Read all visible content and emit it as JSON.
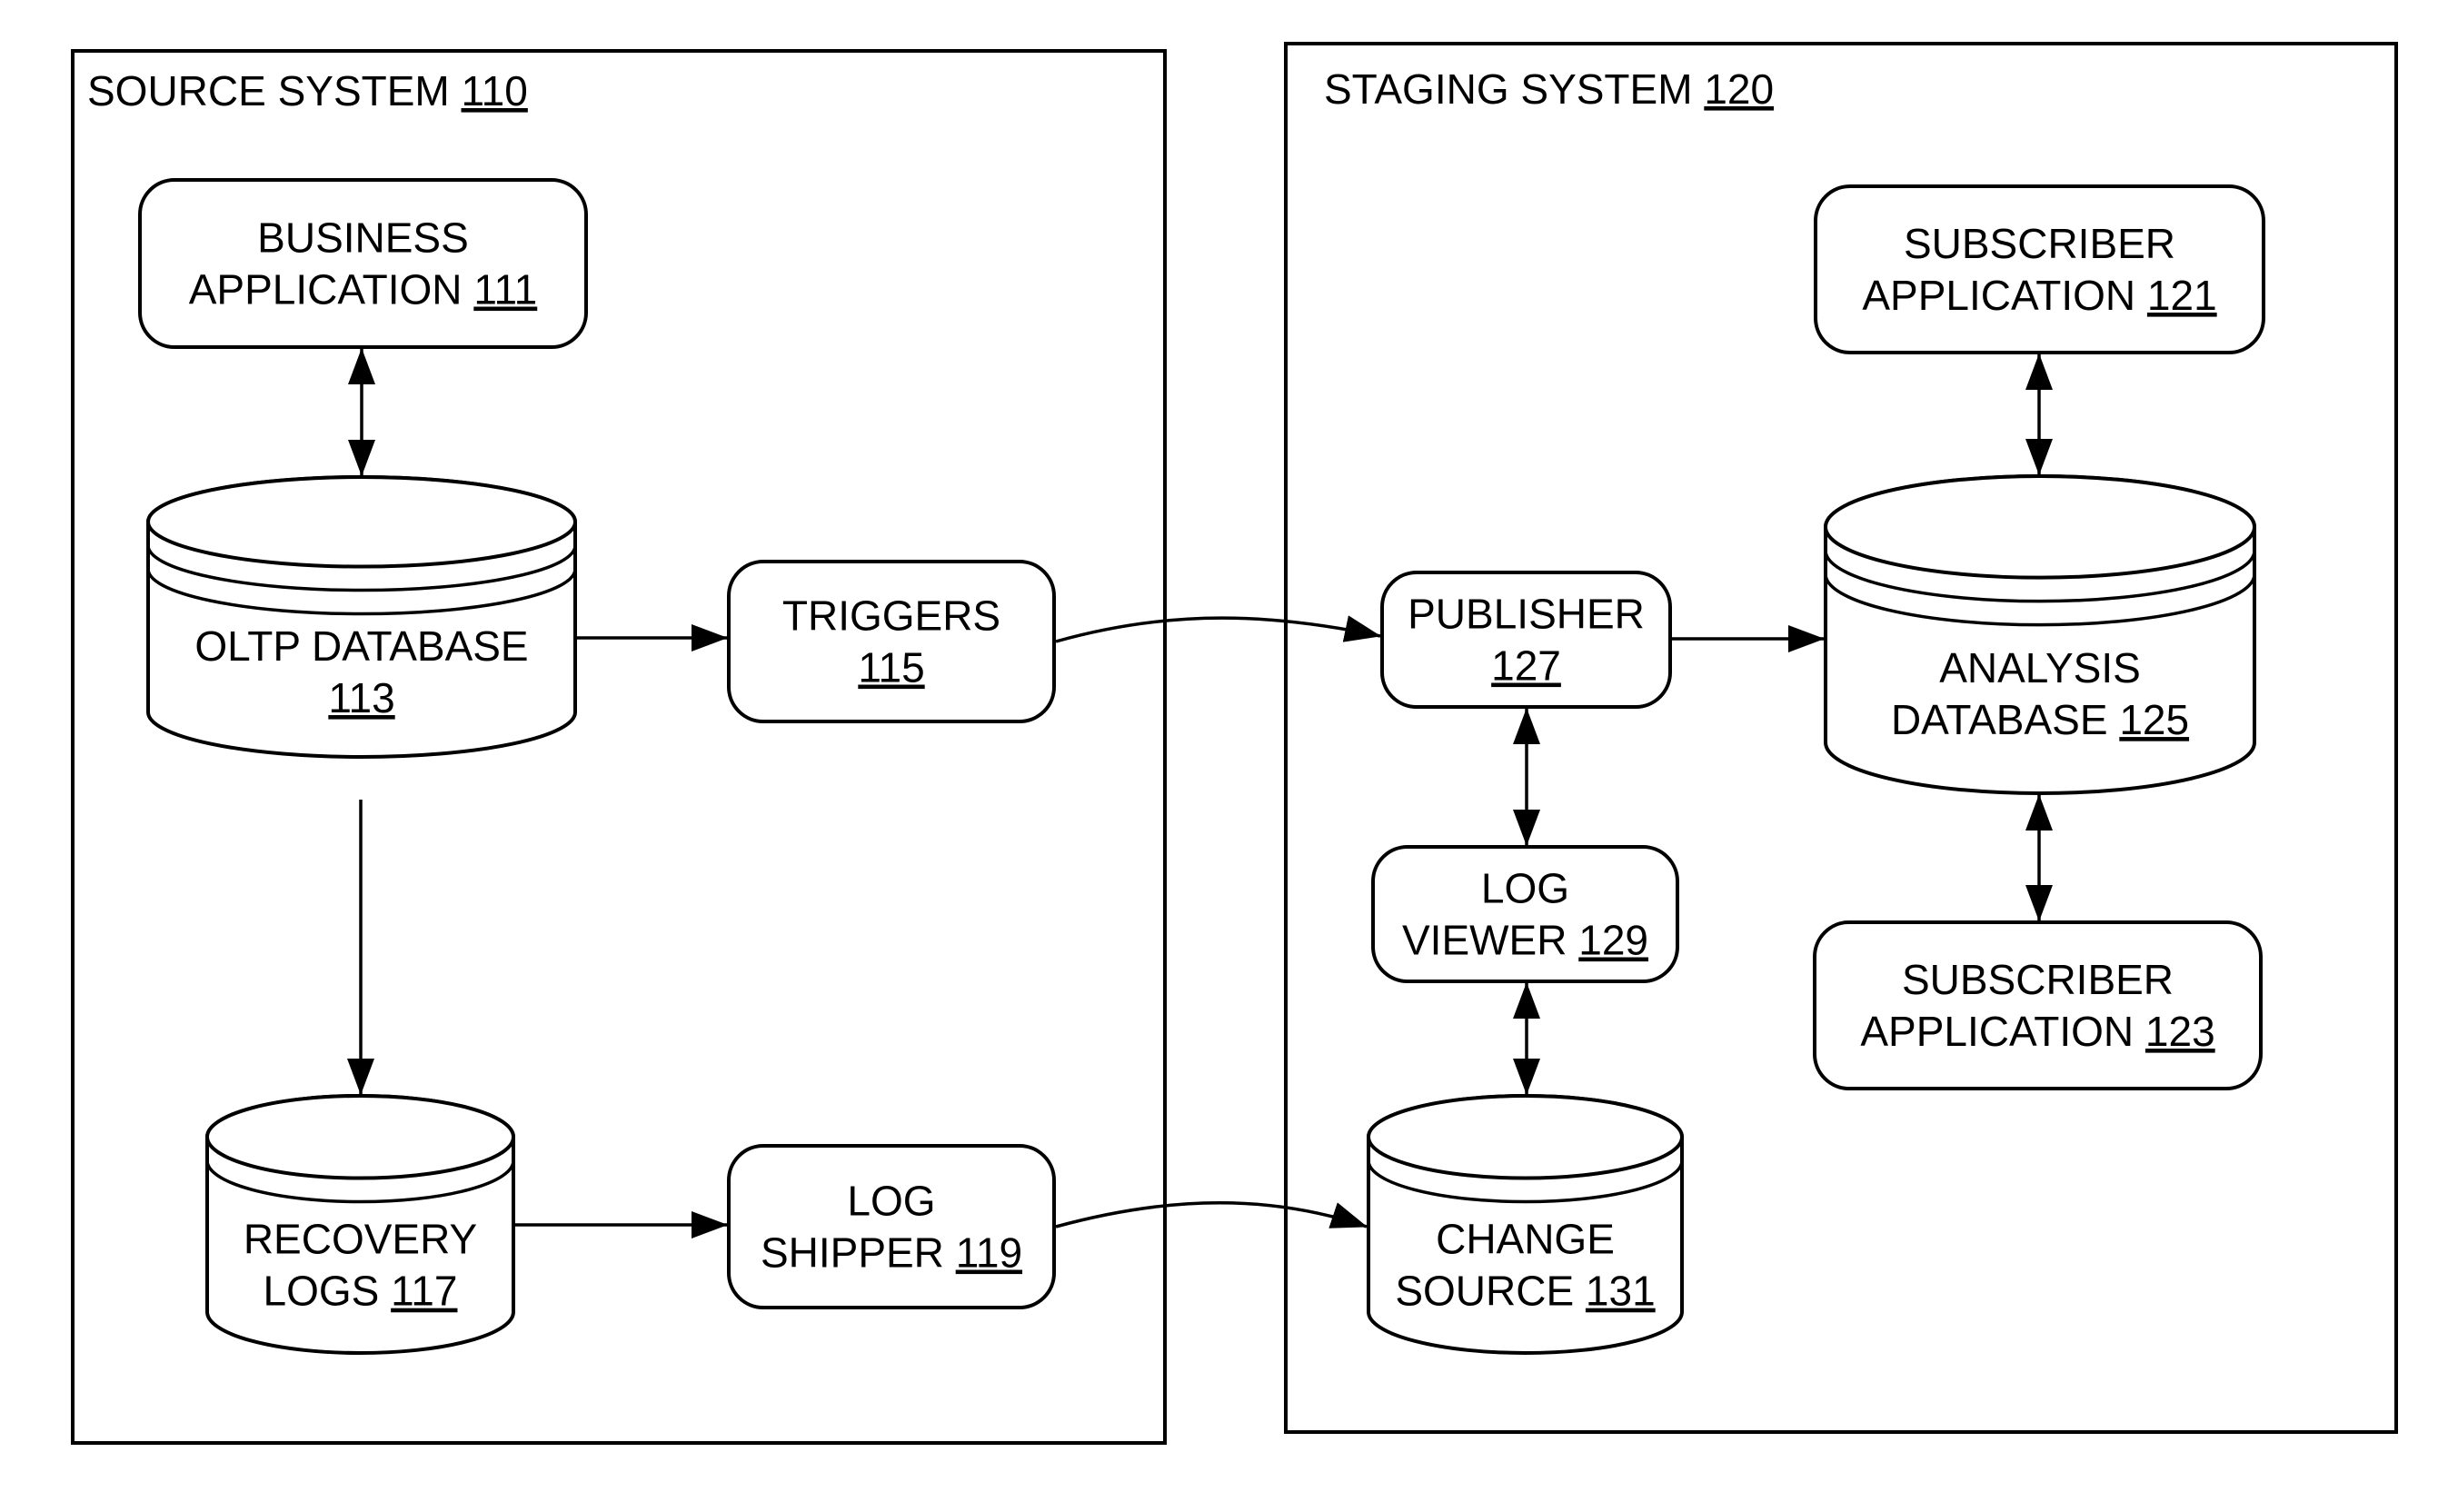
{
  "containers": [
    {
      "id": "source",
      "label": "SOURCE SYSTEM",
      "ref": "110"
    },
    {
      "id": "staging",
      "label": "STAGING SYSTEM",
      "ref": "120"
    }
  ],
  "nodes": [
    {
      "id": "business_app",
      "type": "process",
      "lines": [
        "BUSINESS",
        "APPLICATION"
      ],
      "ref": "111"
    },
    {
      "id": "oltp_db",
      "type": "database",
      "lines": [
        "OLTP DATABASE"
      ],
      "ref": "113",
      "ref_own_line": true
    },
    {
      "id": "triggers",
      "type": "process",
      "lines": [
        "TRIGGERS"
      ],
      "ref": "115",
      "ref_own_line": true
    },
    {
      "id": "recovery_logs",
      "type": "database",
      "lines": [
        "RECOVERY",
        "LOGS"
      ],
      "ref": "117"
    },
    {
      "id": "log_shipper",
      "type": "process",
      "lines": [
        "LOG",
        "SHIPPER"
      ],
      "ref": "119"
    },
    {
      "id": "publisher",
      "type": "process",
      "lines": [
        "PUBLISHER"
      ],
      "ref": "127",
      "ref_own_line": true
    },
    {
      "id": "analysis_db",
      "type": "database",
      "lines": [
        "ANALYSIS",
        "DATABASE"
      ],
      "ref": "125"
    },
    {
      "id": "subscriber_app_121",
      "type": "process",
      "lines": [
        "SUBSCRIBER",
        "APPLICATION"
      ],
      "ref": "121"
    },
    {
      "id": "log_viewer",
      "type": "process",
      "lines": [
        "LOG",
        "VIEWER"
      ],
      "ref": "129"
    },
    {
      "id": "subscriber_app_123",
      "type": "process",
      "lines": [
        "SUBSCRIBER",
        "APPLICATION"
      ],
      "ref": "123"
    },
    {
      "id": "change_source",
      "type": "database",
      "lines": [
        "CHANGE",
        "SOURCE"
      ],
      "ref": "131"
    }
  ],
  "edges": [
    {
      "from": "business_app",
      "to": "oltp_db",
      "direction": "both"
    },
    {
      "from": "oltp_db",
      "to": "triggers",
      "direction": "forward"
    },
    {
      "from": "oltp_db",
      "to": "recovery_logs",
      "direction": "forward"
    },
    {
      "from": "recovery_logs",
      "to": "log_shipper",
      "direction": "forward"
    },
    {
      "from": "triggers",
      "to": "publisher",
      "direction": "forward"
    },
    {
      "from": "log_shipper",
      "to": "change_source",
      "direction": "forward"
    },
    {
      "from": "publisher",
      "to": "analysis_db",
      "direction": "forward"
    },
    {
      "from": "subscriber_app_121",
      "to": "analysis_db",
      "direction": "both"
    },
    {
      "from": "analysis_db",
      "to": "subscriber_app_123",
      "direction": "both"
    },
    {
      "from": "publisher",
      "to": "log_viewer",
      "direction": "both"
    },
    {
      "from": "log_viewer",
      "to": "change_source",
      "direction": "both"
    }
  ]
}
